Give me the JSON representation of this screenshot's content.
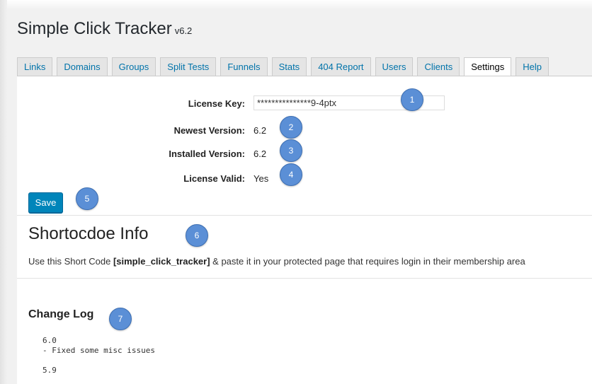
{
  "app": {
    "title": "Simple Click Tracker",
    "version": "v6.2"
  },
  "tabs": [
    {
      "label": "Links"
    },
    {
      "label": "Domains"
    },
    {
      "label": "Groups"
    },
    {
      "label": "Split Tests"
    },
    {
      "label": "Funnels"
    },
    {
      "label": "Stats"
    },
    {
      "label": "404 Report"
    },
    {
      "label": "Users"
    },
    {
      "label": "Clients"
    },
    {
      "label": "Settings"
    },
    {
      "label": "Help"
    }
  ],
  "settings": {
    "license_key_label": "License Key:",
    "license_key_value": "***************9-4ptx",
    "newest_version_label": "Newest Version:",
    "newest_version_value": "6.2",
    "installed_version_label": "Installed Version:",
    "installed_version_value": "6.2",
    "license_valid_label": "License Valid:",
    "license_valid_value": "Yes",
    "save_label": "Save"
  },
  "badges": [
    "1",
    "2",
    "3",
    "4",
    "5",
    "6",
    "7"
  ],
  "shortcode": {
    "heading": "Shortocdoe Info",
    "desc_before": "Use this Short Code ",
    "code": "[simple_click_tracker]",
    "desc_after": " & paste it in your protected page that requires login in their membership area"
  },
  "changelog": {
    "heading": "Change Log",
    "entries": [
      {
        "version": "6.0",
        "notes": [
          "- Fixed some misc issues"
        ]
      },
      {
        "version": "5.9",
        "notes": []
      }
    ]
  },
  "colors": {
    "accent": "#0085ba",
    "badge": "#5b8fd6",
    "link": "#0073aa"
  }
}
